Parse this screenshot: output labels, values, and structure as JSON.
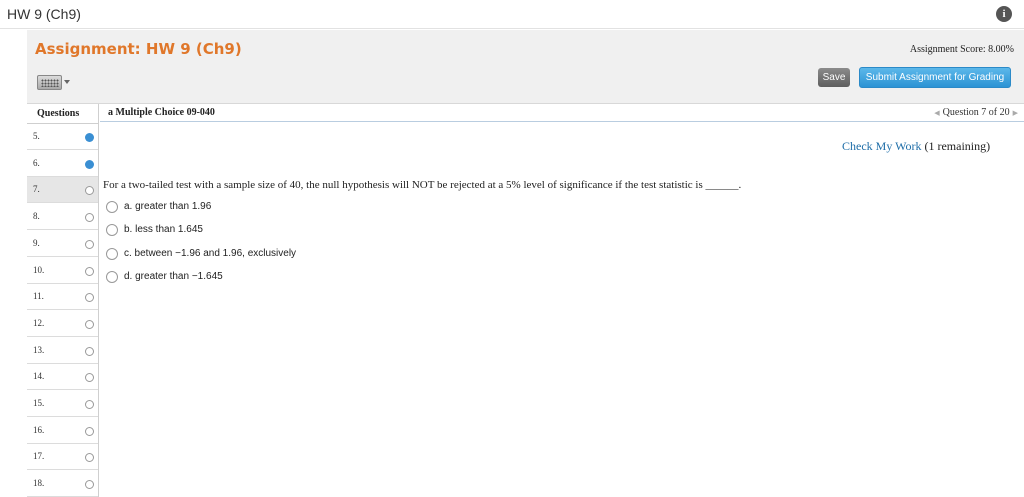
{
  "window": {
    "title": "HW 9 (Ch9)"
  },
  "header": {
    "assignment_title": "Assignment: HW 9 (Ch9)",
    "score_text": "Assignment Score: 8.00%",
    "save_label": "Save",
    "submit_label": "Submit Assignment for Grading"
  },
  "sidebar": {
    "header": "Questions",
    "items": [
      {
        "label": "5.",
        "state": "answered"
      },
      {
        "label": "6.",
        "state": "answered"
      },
      {
        "label": "7.",
        "state": "current"
      },
      {
        "label": "8.",
        "state": "unanswered"
      },
      {
        "label": "9.",
        "state": "unanswered"
      },
      {
        "label": "10.",
        "state": "unanswered"
      },
      {
        "label": "11.",
        "state": "unanswered"
      },
      {
        "label": "12.",
        "state": "unanswered"
      },
      {
        "label": "13.",
        "state": "unanswered"
      },
      {
        "label": "14.",
        "state": "unanswered"
      },
      {
        "label": "15.",
        "state": "unanswered"
      },
      {
        "label": "16.",
        "state": "unanswered"
      },
      {
        "label": "17.",
        "state": "unanswered"
      },
      {
        "label": "18.",
        "state": "unanswered"
      }
    ]
  },
  "main": {
    "question_id": "a Multiple Choice 09-040",
    "nav_text": "Question 7 of 20",
    "check_work_link": "Check My Work",
    "check_work_remaining": "(1 remaining)",
    "question_text": "For a two-tailed test with a sample size of 40, the null hypothesis will NOT be rejected at a 5% level of significance if the test statistic is ______.",
    "options": [
      "a. greater than 1.96",
      "b. less than 1.645",
      "c. between −1.96 and 1.96, exclusively",
      "d. greater than −1.645"
    ]
  },
  "colors": {
    "title_orange": "#e0772a",
    "link_blue": "#1f6ea8",
    "answered_dot": "#3a8fd3",
    "submit_blue": "#2c93d4"
  },
  "icons": {
    "info": "info-icon",
    "keyboard": "keyboard-icon",
    "nav_prev": "triangle-left-icon",
    "nav_next": "triangle-right-icon"
  }
}
